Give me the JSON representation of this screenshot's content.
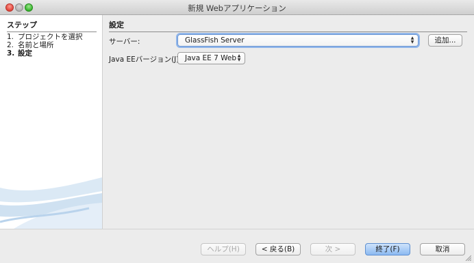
{
  "window": {
    "title": "新規 Webアプリケーション"
  },
  "steps_panel": {
    "heading": "ステップ",
    "items": [
      {
        "num": "1.",
        "label": "プロジェクトを選択"
      },
      {
        "num": "2.",
        "label": "名前と場所"
      },
      {
        "num": "3.",
        "label": "設定"
      }
    ]
  },
  "settings_panel": {
    "heading": "設定",
    "server_label": "サーバー:",
    "server_value": "GlassFish Server",
    "add_button": "追加...",
    "javaee_label": "Java EEバージョン(J):",
    "javaee_value": "Java EE 7 Web"
  },
  "buttons": {
    "help": "ヘルプ(H)",
    "back": "< 戻る(B)",
    "next": "次 >",
    "finish": "終了(F)",
    "cancel": "取消"
  },
  "icons": {
    "select_arrows": "▲▼"
  }
}
